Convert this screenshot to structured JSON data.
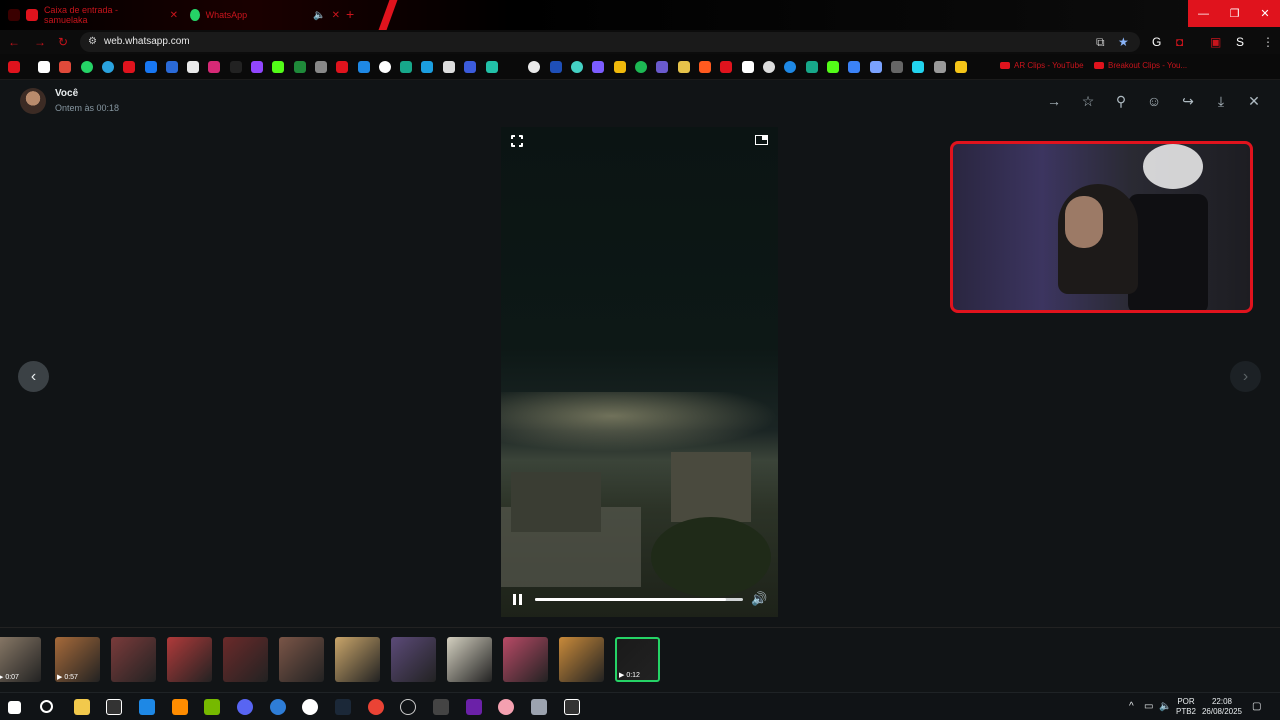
{
  "browser": {
    "tabs": [
      {
        "title": "Caixa de entrada - samuelaka",
        "favicon_color": "#e0131d"
      },
      {
        "title": "WhatsApp",
        "favicon_color": "#25d366"
      }
    ],
    "url": "web.whatsapp.com",
    "bookmark_labels": [
      "AR Clips - YouTube",
      "Breakout Clips - You..."
    ],
    "window_controls": [
      "—",
      "❐",
      "✕"
    ],
    "accent_color": "#e0131d"
  },
  "viewer": {
    "sender": "Você",
    "timestamp": "Ontem às 00:18",
    "top_actions": [
      "→",
      "☆",
      "⚲",
      "☺",
      "↪",
      "⤓",
      "✕"
    ],
    "prev_arrow": "‹",
    "next_arrow": "›",
    "video": {
      "progress": 0.92,
      "volume_icon": "🔊"
    },
    "thumbnails": [
      {
        "duration": "0:07",
        "color": "#8a7a68"
      },
      {
        "duration": "0:57",
        "color": "#a66a3a"
      },
      {
        "duration": "",
        "color": "#7a3b3b"
      },
      {
        "duration": "",
        "color": "#b03a3a"
      },
      {
        "duration": "",
        "color": "#6b2a2a"
      },
      {
        "duration": "",
        "color": "#7a5547"
      },
      {
        "duration": "",
        "color": "#c9a56a"
      },
      {
        "duration": "",
        "color": "#5b4a78"
      },
      {
        "duration": "",
        "color": "#d4d0c0"
      },
      {
        "duration": "",
        "color": "#b84a66"
      },
      {
        "duration": "",
        "color": "#c98a3a"
      },
      {
        "duration": "0:12",
        "color": "#1a1a1a"
      }
    ],
    "active_thumb_color": "#25d366"
  },
  "taskbar": {
    "language_top": "POR",
    "language_bottom": "PTB2",
    "time": "22:08",
    "date": "26/08/2025"
  }
}
